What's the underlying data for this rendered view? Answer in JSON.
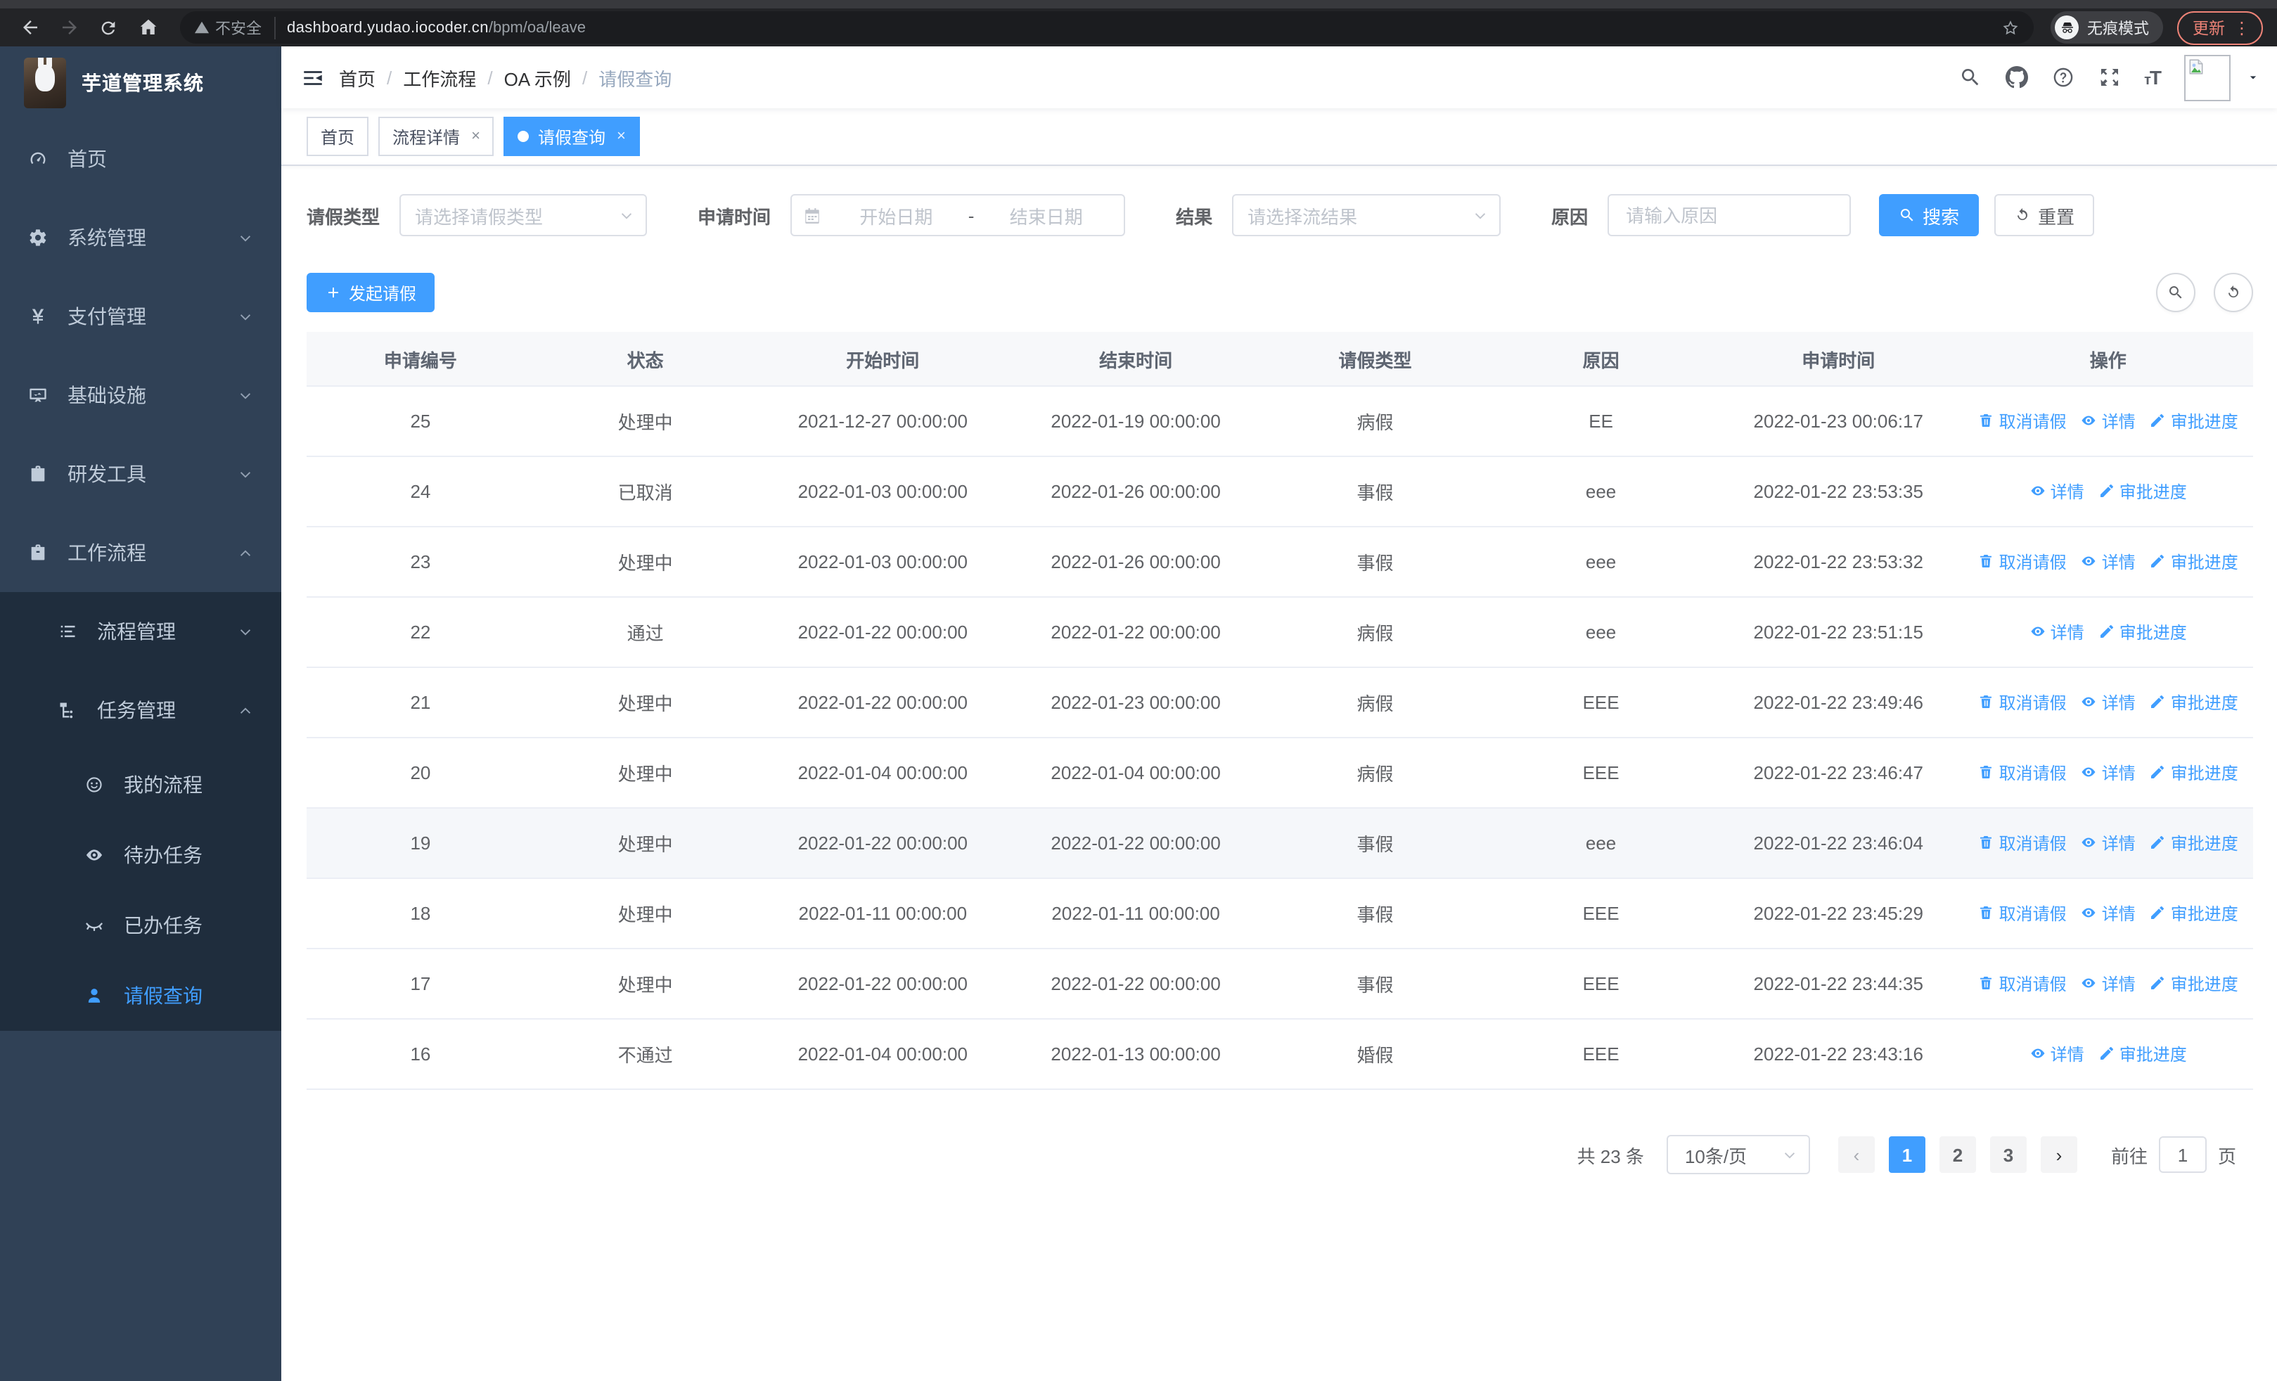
{
  "browser": {
    "security_label": "不安全",
    "url_host": "dashboard.yudao.iocoder.cn",
    "url_path": "/bpm/oa/leave",
    "incognito_label": "无痕模式",
    "update_label": "更新"
  },
  "sidebar": {
    "logo_title": "芋道管理系统",
    "menu": [
      {
        "key": "home",
        "label": "首页",
        "icon": "dashboard-icon",
        "level": 1
      },
      {
        "key": "system",
        "label": "系统管理",
        "icon": "gear-icon",
        "level": 1,
        "chevron": "down"
      },
      {
        "key": "payment",
        "label": "支付管理",
        "icon": "currency-yen-icon",
        "level": 1,
        "chevron": "down"
      },
      {
        "key": "infra",
        "label": "基础设施",
        "icon": "monitor-icon",
        "level": 1,
        "chevron": "down"
      },
      {
        "key": "devtools",
        "label": "研发工具",
        "icon": "toolbox-icon",
        "level": 1,
        "chevron": "down"
      },
      {
        "key": "workflow",
        "label": "工作流程",
        "icon": "briefcase-icon",
        "level": 1,
        "chevron": "up"
      },
      {
        "key": "process-mgmt",
        "label": "流程管理",
        "icon": "list-settings-icon",
        "level": 2,
        "chevron": "down",
        "sub": true
      },
      {
        "key": "task-mgmt",
        "label": "任务管理",
        "icon": "flow-tree-icon",
        "level": 2,
        "chevron": "up",
        "sub": true
      },
      {
        "key": "my-process",
        "label": "我的流程",
        "icon": "robot-face-icon",
        "level": 3,
        "sub": true
      },
      {
        "key": "todo-tasks",
        "label": "待办任务",
        "icon": "eye-open-icon",
        "level": 3,
        "sub": true
      },
      {
        "key": "done-tasks",
        "label": "已办任务",
        "icon": "eye-closed-icon",
        "level": 3,
        "sub": true
      },
      {
        "key": "leave-query",
        "label": "请假查询",
        "icon": "user-icon",
        "level": 3,
        "sub": true,
        "active": true
      }
    ]
  },
  "header": {
    "breadcrumb": [
      "首页",
      "工作流程",
      "OA 示例",
      "请假查询"
    ]
  },
  "tabs": [
    {
      "key": "home",
      "label": "首页",
      "closable": false,
      "active": false
    },
    {
      "key": "process-detail",
      "label": "流程详情",
      "closable": true,
      "active": false
    },
    {
      "key": "leave-query",
      "label": "请假查询",
      "closable": true,
      "active": true
    }
  ],
  "filters": {
    "leave_type_label": "请假类型",
    "leave_type_placeholder": "请选择请假类型",
    "apply_time_label": "申请时间",
    "date_start_placeholder": "开始日期",
    "date_separator": "-",
    "date_end_placeholder": "结束日期",
    "result_label": "结果",
    "result_placeholder": "请选择流结果",
    "reason_label": "原因",
    "reason_placeholder": "请输入原因",
    "search_button": "搜索",
    "reset_button": "重置"
  },
  "toolbar": {
    "create_button": "发起请假"
  },
  "table": {
    "columns": [
      "申请编号",
      "状态",
      "开始时间",
      "结束时间",
      "请假类型",
      "原因",
      "申请时间",
      "操作"
    ],
    "action_labels": {
      "cancel": "取消请假",
      "detail": "详情",
      "progress": "审批进度"
    },
    "rows": [
      {
        "id": "25",
        "status": "处理中",
        "start": "2021-12-27 00:00:00",
        "end": "2022-01-19 00:00:00",
        "type": "病假",
        "reason": "EE",
        "applied": "2022-01-23 00:06:17",
        "actions": [
          "cancel",
          "detail",
          "progress"
        ],
        "hover": false
      },
      {
        "id": "24",
        "status": "已取消",
        "start": "2022-01-03 00:00:00",
        "end": "2022-01-26 00:00:00",
        "type": "事假",
        "reason": "eee",
        "applied": "2022-01-22 23:53:35",
        "actions": [
          "detail",
          "progress"
        ],
        "hover": false
      },
      {
        "id": "23",
        "status": "处理中",
        "start": "2022-01-03 00:00:00",
        "end": "2022-01-26 00:00:00",
        "type": "事假",
        "reason": "eee",
        "applied": "2022-01-22 23:53:32",
        "actions": [
          "cancel",
          "detail",
          "progress"
        ],
        "hover": false
      },
      {
        "id": "22",
        "status": "通过",
        "start": "2022-01-22 00:00:00",
        "end": "2022-01-22 00:00:00",
        "type": "病假",
        "reason": "eee",
        "applied": "2022-01-22 23:51:15",
        "actions": [
          "detail",
          "progress"
        ],
        "hover": false
      },
      {
        "id": "21",
        "status": "处理中",
        "start": "2022-01-22 00:00:00",
        "end": "2022-01-23 00:00:00",
        "type": "病假",
        "reason": "EEE",
        "applied": "2022-01-22 23:49:46",
        "actions": [
          "cancel",
          "detail",
          "progress"
        ],
        "hover": false
      },
      {
        "id": "20",
        "status": "处理中",
        "start": "2022-01-04 00:00:00",
        "end": "2022-01-04 00:00:00",
        "type": "病假",
        "reason": "EEE",
        "applied": "2022-01-22 23:46:47",
        "actions": [
          "cancel",
          "detail",
          "progress"
        ],
        "hover": false
      },
      {
        "id": "19",
        "status": "处理中",
        "start": "2022-01-22 00:00:00",
        "end": "2022-01-22 00:00:00",
        "type": "事假",
        "reason": "eee",
        "applied": "2022-01-22 23:46:04",
        "actions": [
          "cancel",
          "detail",
          "progress"
        ],
        "hover": true
      },
      {
        "id": "18",
        "status": "处理中",
        "start": "2022-01-11 00:00:00",
        "end": "2022-01-11 00:00:00",
        "type": "事假",
        "reason": "EEE",
        "applied": "2022-01-22 23:45:29",
        "actions": [
          "cancel",
          "detail",
          "progress"
        ],
        "hover": false
      },
      {
        "id": "17",
        "status": "处理中",
        "start": "2022-01-22 00:00:00",
        "end": "2022-01-22 00:00:00",
        "type": "事假",
        "reason": "EEE",
        "applied": "2022-01-22 23:44:35",
        "actions": [
          "cancel",
          "detail",
          "progress"
        ],
        "hover": false
      },
      {
        "id": "16",
        "status": "不通过",
        "start": "2022-01-04 00:00:00",
        "end": "2022-01-13 00:00:00",
        "type": "婚假",
        "reason": "EEE",
        "applied": "2022-01-22 23:43:16",
        "actions": [
          "detail",
          "progress"
        ],
        "hover": false
      }
    ]
  },
  "pagination": {
    "total_text": "共 23 条",
    "page_size": "10条/页",
    "pages": [
      "1",
      "2",
      "3"
    ],
    "active_page": "1",
    "goto_label": "前往",
    "goto_value": "1",
    "goto_suffix": "页"
  },
  "colors": {
    "primary": "#409eff",
    "sidebar_bg": "#304156",
    "submenu_bg": "#1f2d3d",
    "active_link": "#409eff",
    "update_accent": "#ee8377",
    "table_border": "#ebeef5"
  }
}
